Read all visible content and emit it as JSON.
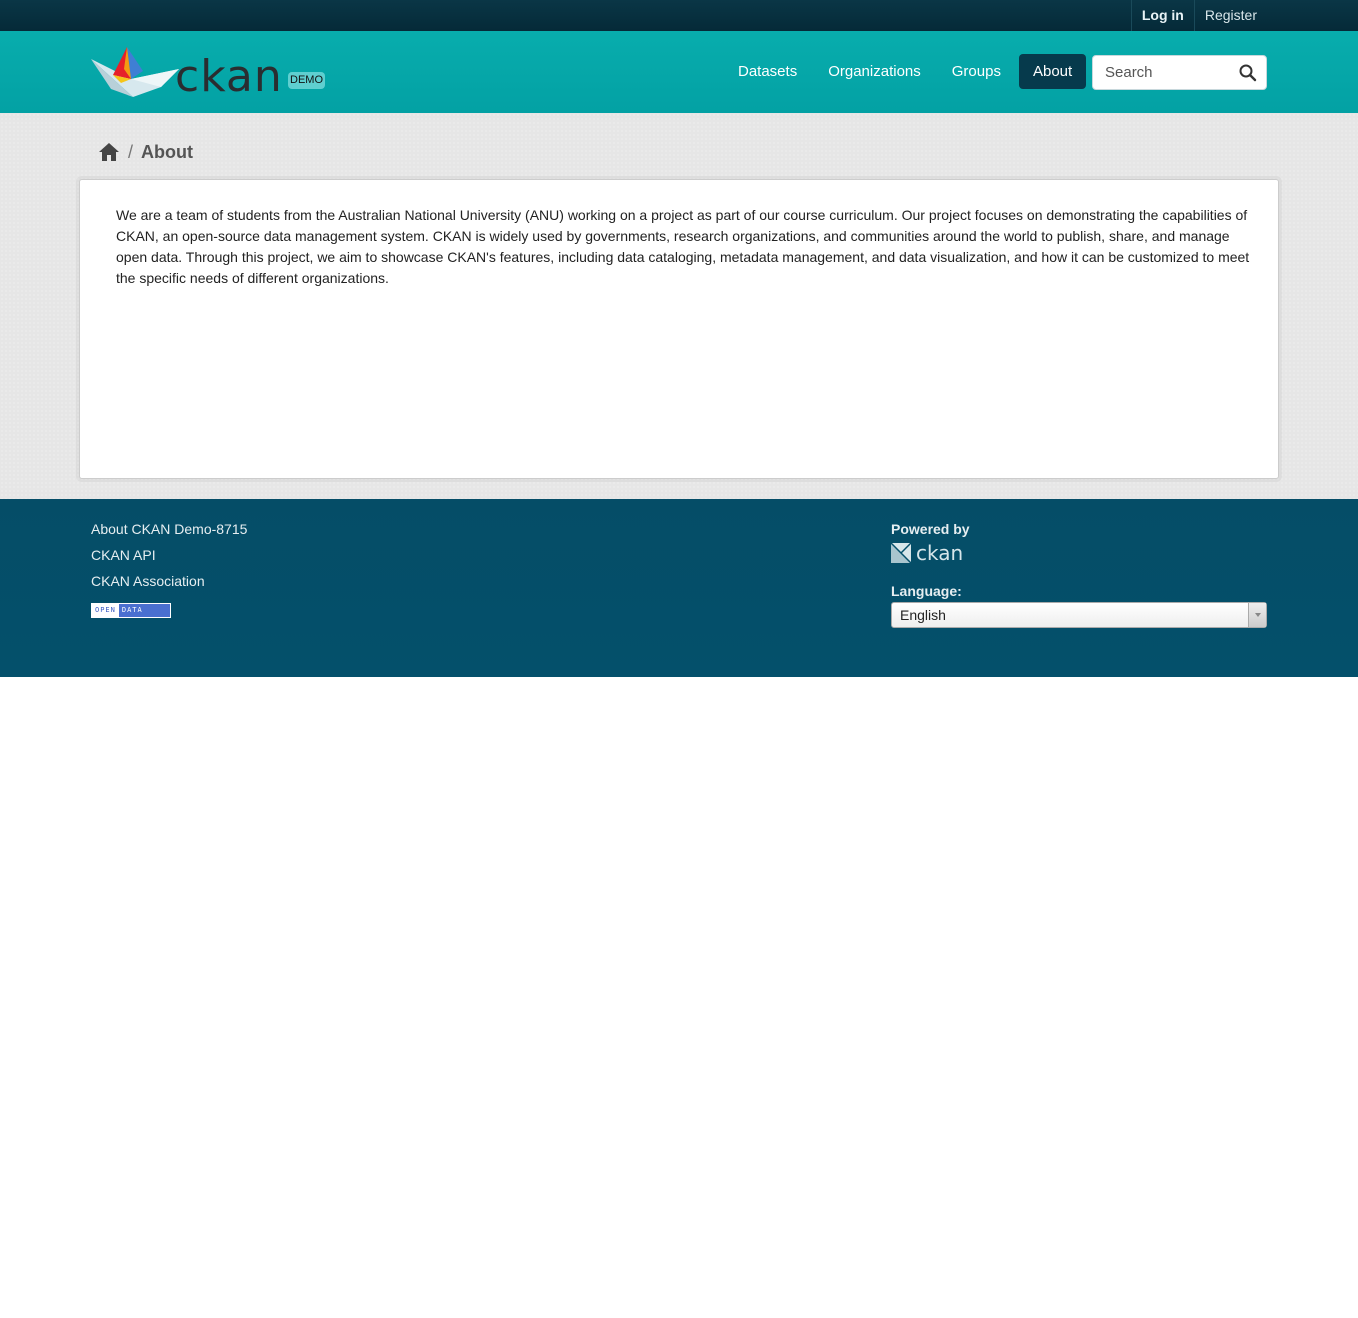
{
  "account": {
    "login_label": "Log in",
    "register_label": "Register"
  },
  "site": {
    "logo_text": "ckan",
    "badge": "DEMO"
  },
  "nav": {
    "items": [
      {
        "label": "Datasets"
      },
      {
        "label": "Organizations"
      },
      {
        "label": "Groups"
      },
      {
        "label": "About",
        "active": true
      }
    ]
  },
  "search": {
    "placeholder": "Search"
  },
  "breadcrumb": {
    "separator": "/",
    "current": "About"
  },
  "about": {
    "text": "We are a team of students from the Australian National University (ANU) working on a project as part of our course curriculum. Our project focuses on demonstrating the capabilities of CKAN, an open-source data management system. CKAN is widely used by governments, research organizations, and communities around the world to publish, share, and manage open data. Through this project, we aim to showcase CKAN's features, including data cataloging, metadata management, and data visualization, and how it can be customized to meet the specific needs of different organizations."
  },
  "footer": {
    "links": [
      {
        "label": "About CKAN Demo-8715"
      },
      {
        "label": "CKAN API"
      },
      {
        "label": "CKAN Association"
      }
    ],
    "open_data_badge": {
      "part1": "OPEN",
      "part2": "DATA"
    },
    "powered_by": "Powered by",
    "powered_logo_text": "ckan",
    "language_label": "Language:",
    "language_selected": "English"
  },
  "colors": {
    "account_bar": "#062f3f",
    "masthead": "#06a7a9",
    "nav_active": "#063a4c",
    "footer": "#044f6a",
    "content_bg": "#e9e9e9"
  }
}
